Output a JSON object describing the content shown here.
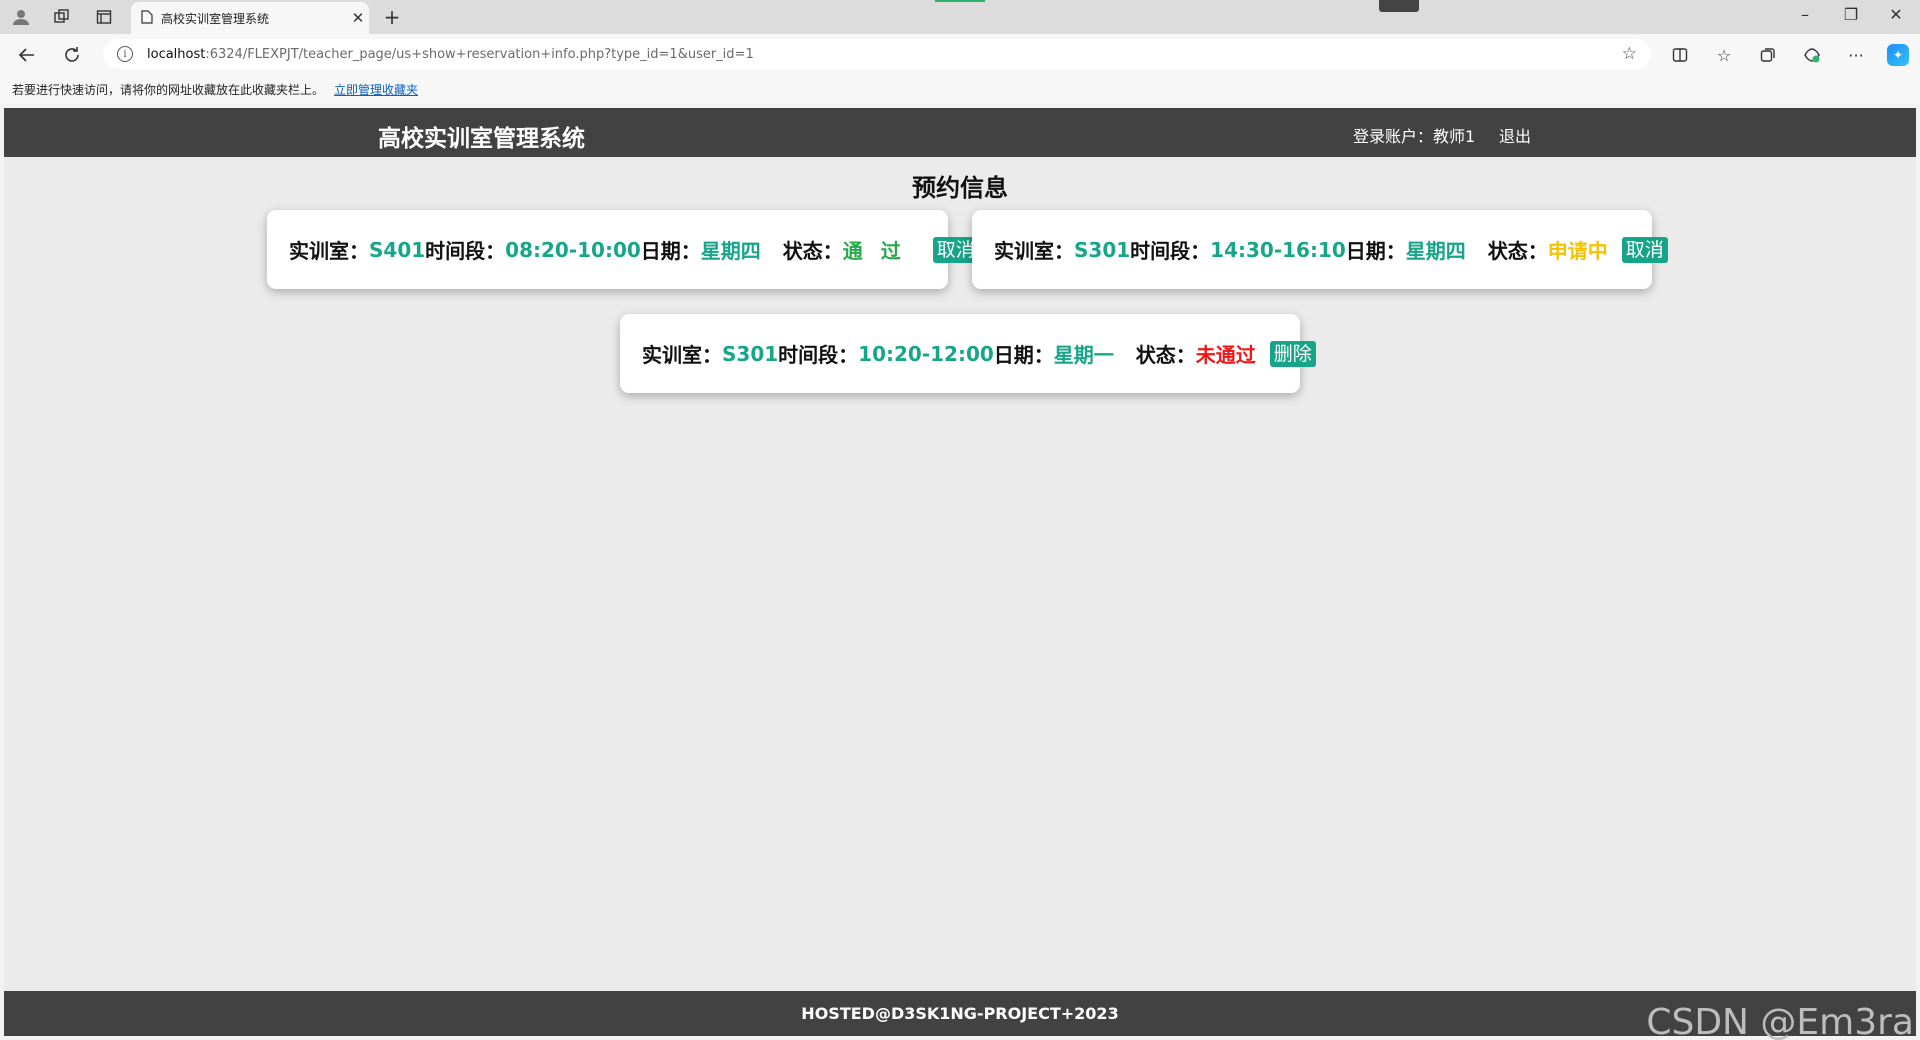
{
  "browser": {
    "tab_title": "高校实训室管理系统",
    "url_host": "localhost",
    "url_rest": ":6324/FLEXPJT/teacher_page/us+show+reservation+info.php?type_id=1&user_id=1",
    "favorites_hint": "若要进行快速访问，请将你的网址收藏放在此收藏夹栏上。",
    "favorites_link": "立即管理收藏夹"
  },
  "icons": {
    "profile": "profile-icon",
    "workspaces": "workspaces-icon",
    "tab_actions": "tab-actions-icon",
    "page": "page-icon",
    "close": "close-icon",
    "new_tab": "plus-icon",
    "back": "back-arrow-icon",
    "reload": "reload-icon",
    "info": "info-icon",
    "star": "star-icon",
    "split": "split-screen-icon",
    "favorites": "favorites-icon",
    "collections": "collections-icon",
    "extensions": "extensions-icon",
    "more": "more-icon",
    "copilot": "copilot-icon"
  },
  "header": {
    "title": "高校实训室管理系统",
    "account": "登录账户：教师1",
    "logout": "退出"
  },
  "section_title": "预约信息",
  "labels": {
    "room": "实训室：",
    "time": "时间段：",
    "date": "日期：",
    "status": "状态："
  },
  "reservations": [
    {
      "room": "S401",
      "time": "08:20-10:00",
      "date": "星期四",
      "status": "通过",
      "status_type": "pass",
      "action": "取消"
    },
    {
      "room": "S301",
      "time": "14:30-16:10",
      "date": "星期四",
      "status": "申请中",
      "status_type": "pending",
      "action": "取消"
    },
    {
      "room": "S301",
      "time": "10:20-12:00",
      "date": "星期一",
      "status": "未通过",
      "status_type": "reject",
      "action": "删除"
    }
  ],
  "footer": "HOSTED@D3SK1NG-PROJECT+2023",
  "watermark": "CSDN @Em3ra",
  "colors": {
    "header_bg": "#424242",
    "accent": "#17a689",
    "pass": "#27a84a",
    "pending": "#f5c400",
    "reject": "#ee1616"
  }
}
